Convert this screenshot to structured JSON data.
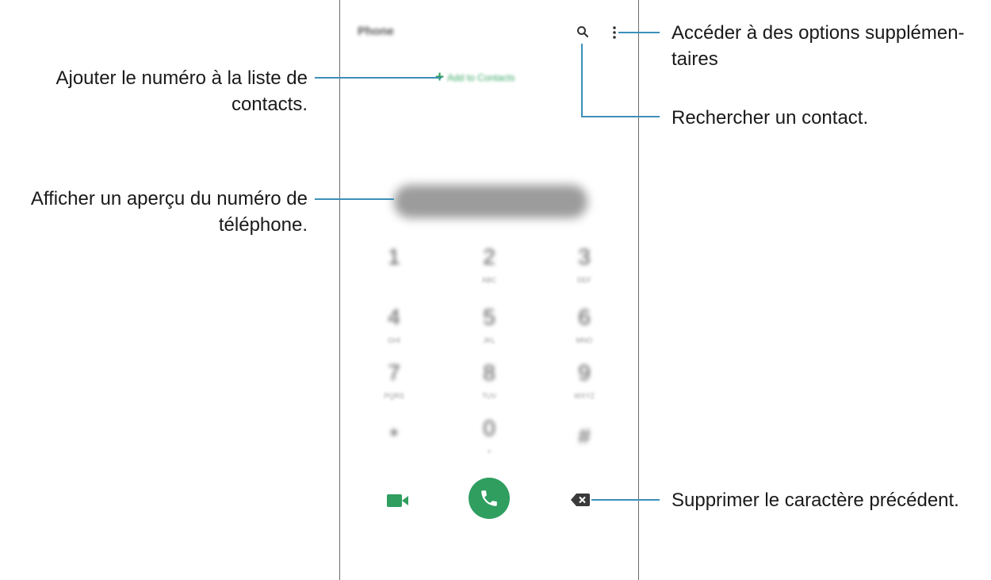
{
  "phone": {
    "app_title": "Phone",
    "add_to_contacts": "Add to Contacts",
    "icons": {
      "search": "search-icon",
      "more": "more-options-icon",
      "video_call": "video-call-icon",
      "voice_call": "phone-call-icon",
      "backspace": "backspace-icon"
    },
    "keypad": [
      {
        "digit": "1",
        "letters": ""
      },
      {
        "digit": "2",
        "letters": "ABC"
      },
      {
        "digit": "3",
        "letters": "DEF"
      },
      {
        "digit": "4",
        "letters": "GHI"
      },
      {
        "digit": "5",
        "letters": "JKL"
      },
      {
        "digit": "6",
        "letters": "MNO"
      },
      {
        "digit": "7",
        "letters": "PQRS"
      },
      {
        "digit": "8",
        "letters": "TUV"
      },
      {
        "digit": "9",
        "letters": "WXYZ"
      },
      {
        "digit": "*",
        "letters": ""
      },
      {
        "digit": "0",
        "letters": "+"
      },
      {
        "digit": "#",
        "letters": ""
      }
    ],
    "colors": {
      "accent_green": "#2f9e5f",
      "callout_line": "#3d8fb8"
    }
  },
  "callouts": {
    "more_options": {
      "line1": "Accéder à des options supplémen-",
      "line2": "taires"
    },
    "search": "Rechercher un contact.",
    "add_contact": {
      "line1": "Ajouter le numéro à la liste de",
      "line2": "contacts."
    },
    "preview": {
      "line1": "Afficher un aperçu du numéro de",
      "line2": "téléphone."
    },
    "delete": "Supprimer le caractère précédent."
  }
}
